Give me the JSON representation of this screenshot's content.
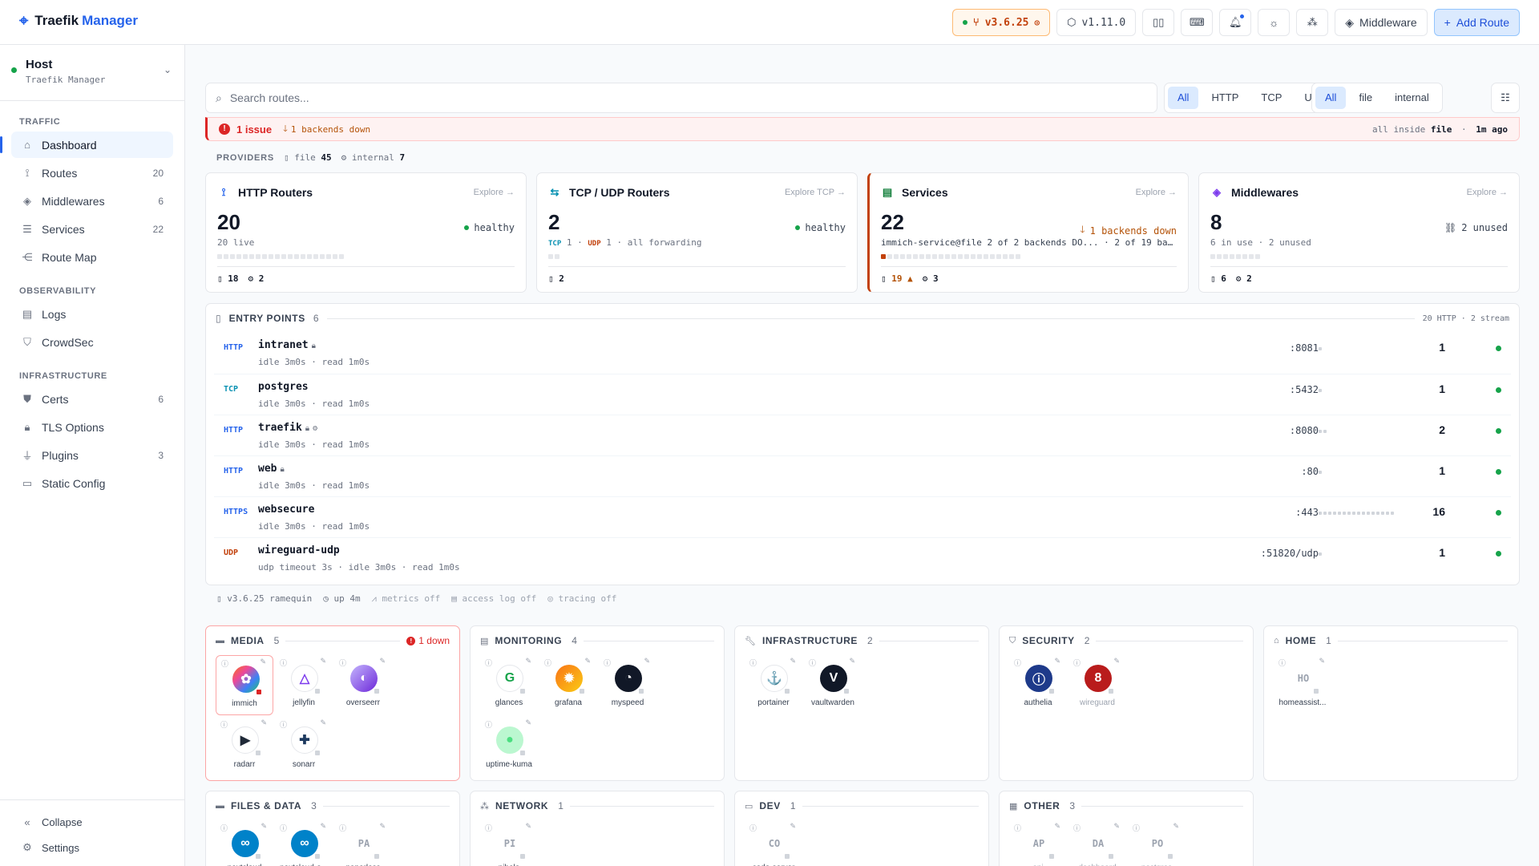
{
  "app": {
    "brand_main": "Traefik",
    "brand_accent": "Manager"
  },
  "topbar": {
    "version": "v3.6.25",
    "manager_version": "v1.11.0",
    "middleware_label": "Middleware",
    "add_route_label": "Add Route"
  },
  "host": {
    "name": "Host",
    "sub": "Traefik Manager"
  },
  "nav": {
    "traffic_label": "TRAFFIC",
    "observability_label": "OBSERVABILITY",
    "infrastructure_label": "INFRASTRUCTURE",
    "traffic": [
      {
        "label": "Dashboard",
        "icon": "home-icon",
        "count": ""
      },
      {
        "label": "Routes",
        "icon": "route-icon",
        "count": "20"
      },
      {
        "label": "Middlewares",
        "icon": "layers-icon",
        "count": "6"
      },
      {
        "label": "Services",
        "icon": "server-icon",
        "count": "22"
      },
      {
        "label": "Route Map",
        "icon": "graph-icon",
        "count": ""
      }
    ],
    "observability": [
      {
        "label": "Logs",
        "icon": "logs-icon"
      },
      {
        "label": "CrowdSec",
        "icon": "shield-icon"
      }
    ],
    "infrastructure": [
      {
        "label": "Certs",
        "icon": "cert-icon",
        "count": "6"
      },
      {
        "label": "TLS Options",
        "icon": "lock-icon",
        "count": ""
      },
      {
        "label": "Plugins",
        "icon": "plug-icon",
        "count": "3"
      },
      {
        "label": "Static Config",
        "icon": "file-icon",
        "count": ""
      }
    ],
    "collapse_label": "Collapse",
    "settings_label": "Settings"
  },
  "search": {
    "placeholder": "Search routes..."
  },
  "protocol_filter": [
    "All",
    "HTTP",
    "TCP",
    "UDP"
  ],
  "provider_filter": [
    "All",
    "file",
    "internal"
  ],
  "issue": {
    "title": "1 issue",
    "detail": "1 backends down",
    "scope_prefix": "all inside",
    "scope_value": "file",
    "sep": "·",
    "ago": "1m ago"
  },
  "providers": {
    "label": "PROVIDERS",
    "file": "file",
    "file_count": "45",
    "internal": "internal",
    "internal_count": "7"
  },
  "cards": {
    "http": {
      "title": "HTTP Routers",
      "explore": "Explore",
      "count": "20",
      "status": "healthy",
      "sub": "20 live",
      "foot_file": "18",
      "foot_int": "2"
    },
    "tcp": {
      "title": "TCP / UDP Routers",
      "explore": "Explore TCP",
      "count": "2",
      "status": "healthy",
      "tcp_label": "TCP",
      "tcp_val": "1",
      "udp_label": "UDP",
      "udp_val": "1",
      "note": "all forwarding",
      "foot_file": "2"
    },
    "services": {
      "title": "Services",
      "explore": "Explore",
      "count": "22",
      "status": "1 backends down",
      "sub": "immich-service@file 2 of 2 backends DO... · 2 of 19 backe...",
      "foot_file": "19",
      "foot_int": "3"
    },
    "middlewares": {
      "title": "Middlewares",
      "explore": "Explore",
      "count": "8",
      "status": "2 unused",
      "sub": "6 in use · 2 unused",
      "foot_file": "6",
      "foot_int": "2"
    }
  },
  "entry_points": {
    "label": "ENTRY POINTS",
    "count": "6",
    "meta": "20 HTTP · 2 stream",
    "rows": [
      {
        "proto": "HTTP",
        "name": "intranet",
        "detail": "idle 3m0s · read 1m0s",
        "port": ":8081",
        "routes": "1"
      },
      {
        "proto": "TCP",
        "name": "postgres",
        "detail": "idle 3m0s · read 1m0s",
        "port": ":5432",
        "routes": "1"
      },
      {
        "proto": "HTTP",
        "name": "traefik",
        "detail": "idle 3m0s · read 1m0s",
        "port": ":8080",
        "routes": "2"
      },
      {
        "proto": "HTTP",
        "name": "web",
        "detail": "idle 3m0s · read 1m0s",
        "port": ":80",
        "routes": "1"
      },
      {
        "proto": "HTTPS",
        "name": "websecure",
        "detail": "idle 3m0s · read 1m0s",
        "port": ":443",
        "routes": "16"
      },
      {
        "proto": "UDP",
        "name": "wireguard-udp",
        "detail": "udp timeout 3s · idle 3m0s · read 1m0s",
        "port": ":51820/udp",
        "routes": "1"
      }
    ]
  },
  "footer": {
    "version": "v3.6.25 ramequin",
    "uptime": "up 4m",
    "metrics": "metrics off",
    "access_log": "access log off",
    "tracing": "tracing off"
  },
  "groups": {
    "media": {
      "label": "MEDIA",
      "count": "5",
      "down": "1 down",
      "apps": [
        "immich",
        "jellyfin",
        "overseerr",
        "radarr",
        "sonarr"
      ]
    },
    "monitoring": {
      "label": "MONITORING",
      "count": "4",
      "apps": [
        "glances",
        "grafana",
        "myspeed",
        "uptime-kuma"
      ]
    },
    "infrastructure": {
      "label": "INFRASTRUCTURE",
      "count": "2",
      "apps": [
        "portainer",
        "vaultwarden"
      ]
    },
    "security": {
      "label": "SECURITY",
      "count": "2",
      "apps": [
        "authelia",
        "wireguard"
      ]
    },
    "home": {
      "label": "HOME",
      "count": "1",
      "apps": [
        "homeassist..."
      ],
      "initials": [
        "HO"
      ]
    },
    "files": {
      "label": "FILES & DATA",
      "count": "3",
      "apps": [
        "nextcloud",
        "nextcloud-o...",
        "paperless"
      ],
      "initials": [
        "PA"
      ]
    },
    "network": {
      "label": "NETWORK",
      "count": "1",
      "apps": [
        "pihole"
      ],
      "initials": [
        "PI"
      ]
    },
    "dev": {
      "label": "DEV",
      "count": "1",
      "apps": [
        "code-server"
      ],
      "initials": [
        "CO"
      ]
    },
    "other": {
      "label": "OTHER",
      "count": "3",
      "apps": [
        "api",
        "dashboard",
        "postgres"
      ],
      "initials": [
        "AP",
        "DA",
        "PO"
      ]
    }
  },
  "colors": {
    "accent": "#2563eb",
    "ok": "#16a34a",
    "danger": "#dc2626",
    "warn": "#c2410c"
  }
}
